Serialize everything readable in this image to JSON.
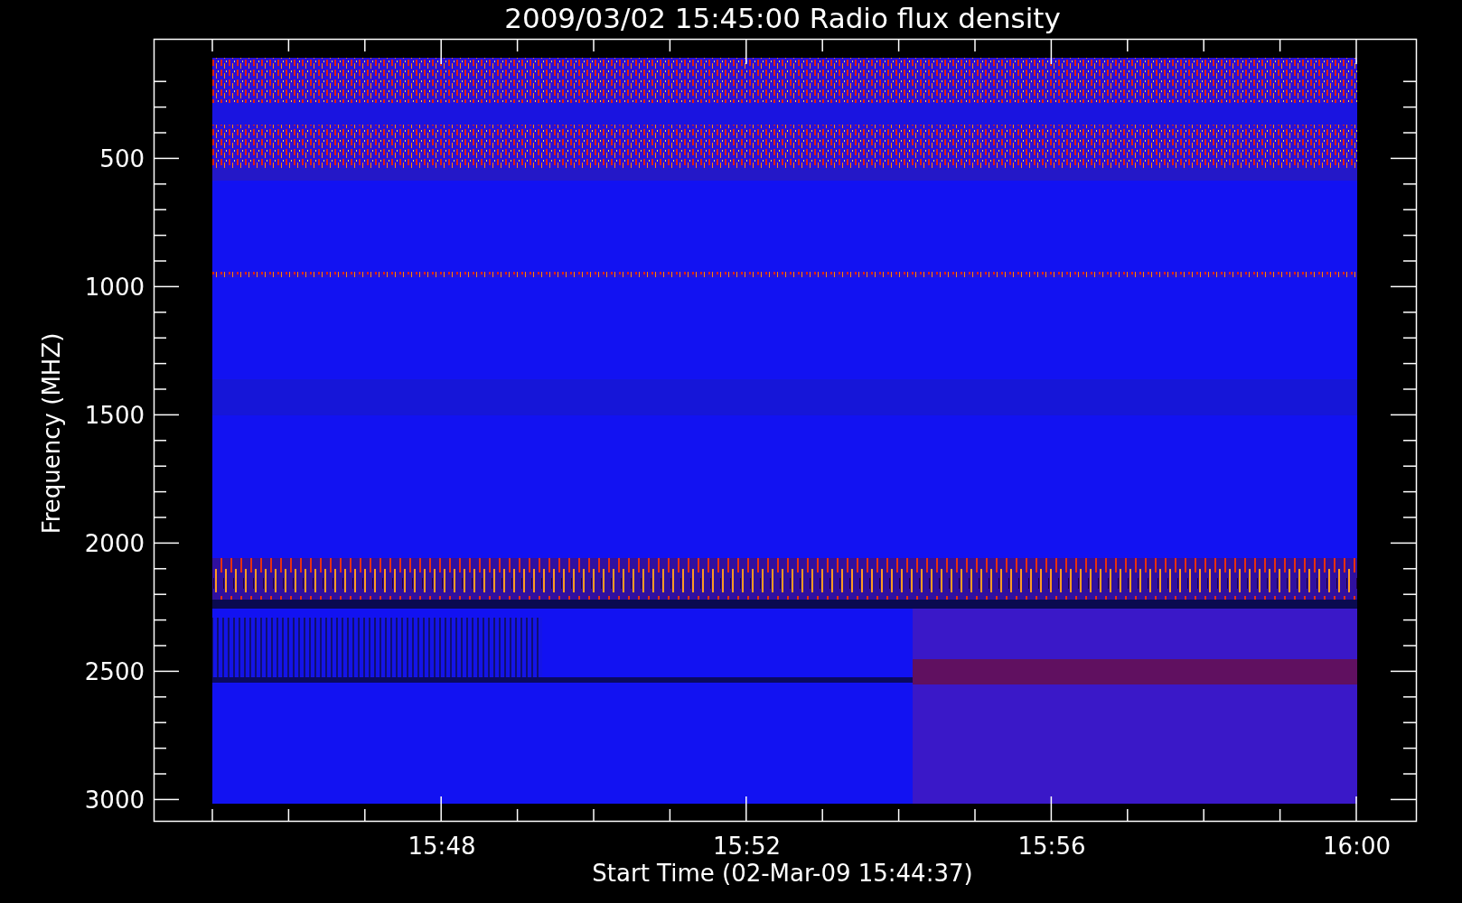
{
  "title": "2009/03/02 15:45:00 Radio flux density",
  "y_axis": {
    "label": "Frequency (MHZ)",
    "ticks": [
      "500",
      "1000",
      "1500",
      "2000",
      "2500",
      "3000"
    ]
  },
  "x_axis": {
    "label": "Start Time (02-Mar-09 15:44:37)",
    "ticks": [
      "15:48",
      "15:52",
      "15:56",
      "16:00"
    ]
  }
}
